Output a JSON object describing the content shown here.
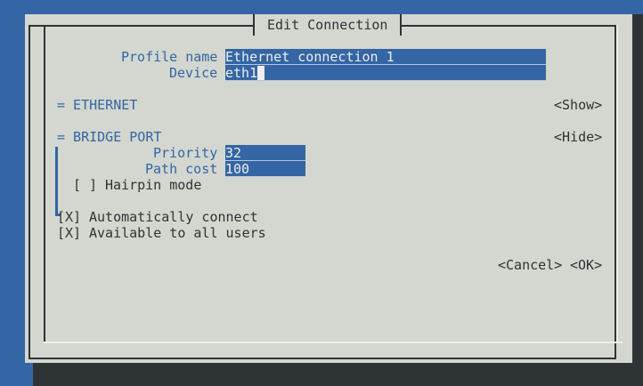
{
  "dialog": {
    "title": "Edit Connection"
  },
  "fields": {
    "profile_name_label": "Profile name",
    "profile_name_value": "Ethernet connection 1",
    "device_label": "Device",
    "device_value": "eth1"
  },
  "ethernet": {
    "section_label": "= ETHERNET",
    "toggle": "<Show>"
  },
  "bridge_port": {
    "section_label": "= BRIDGE PORT",
    "toggle": "<Hide>",
    "priority_label": "Priority",
    "priority_value": "32",
    "path_cost_label": "Path cost",
    "path_cost_value": "100",
    "hairpin_checkbox": "[ ]",
    "hairpin_label": "Hairpin mode"
  },
  "options": {
    "auto_connect_checkbox": "[X]",
    "auto_connect_label": "Automatically connect",
    "all_users_checkbox": "[X]",
    "all_users_label": "Available to all users"
  },
  "buttons": {
    "cancel": "<Cancel>",
    "ok": "<OK>"
  }
}
